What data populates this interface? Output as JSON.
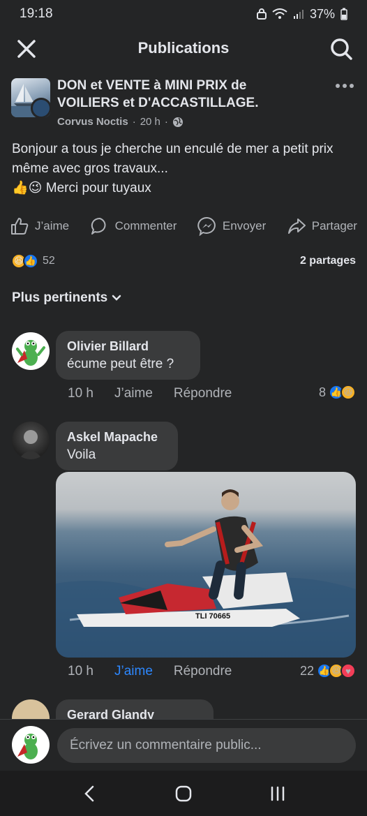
{
  "status_bar": {
    "time": "19:18",
    "battery": "37%"
  },
  "top_bar": {
    "title": "Publications"
  },
  "post": {
    "group_name": "DON et VENTE à MINI PRIX de VOILIERS et D'ACCASTILLAGE.",
    "author": "Corvus Noctis",
    "time": "20 h",
    "separator": "·",
    "text_line1": "Bonjour a tous je cherche un enculé de mer a petit prix même avec gros travaux...",
    "text_line2_emojis": "👍😉",
    "text_line2": "Merci pour tuyaux",
    "actions": {
      "like": "J’aime",
      "comment": "Commenter",
      "send": "Envoyer",
      "share": "Partager"
    },
    "reaction_count": "52",
    "shares": "2 partages"
  },
  "sort_label": "Plus pertinents",
  "comments": [
    {
      "name": "Olivier Billard",
      "text": "écume peut être ?",
      "time": "10 h",
      "like": "J’aime",
      "reply": "Répondre",
      "reactions": "8"
    },
    {
      "name": "Askel Mapache",
      "text": "Voila",
      "time": "10 h",
      "like": "J’aime",
      "reply": "Répondre",
      "reactions": "22",
      "photo_caption": "TLI 70665"
    },
    {
      "name": "Gerard Glandy"
    }
  ],
  "composer": {
    "placeholder": "Écrivez un commentaire public..."
  },
  "colors": {
    "background": "#242526",
    "bubble": "#3a3b3c",
    "accent": "#2d88ff"
  },
  "icons": [
    "close-icon",
    "search-icon",
    "more-icon",
    "globe-icon",
    "like-icon",
    "comment-icon",
    "messenger-icon",
    "share-icon",
    "chevron-down-icon",
    "back-icon",
    "home-icon",
    "recents-icon"
  ]
}
